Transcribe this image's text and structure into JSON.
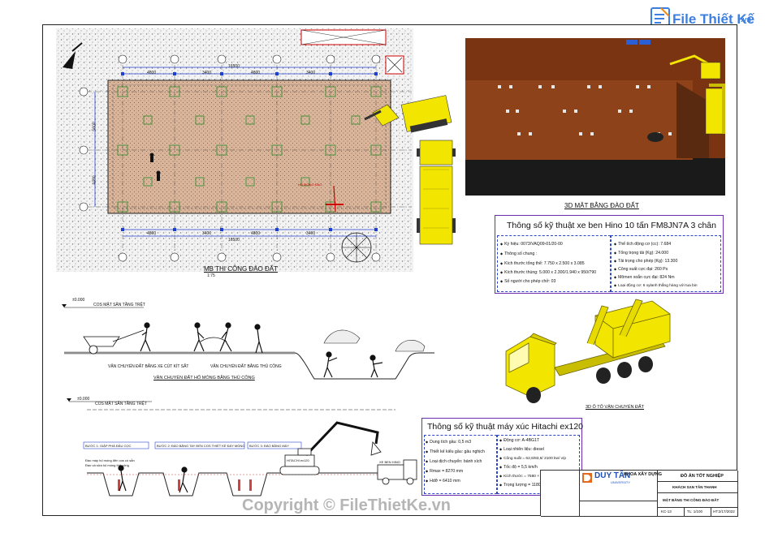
{
  "watermark_top": {
    "brand": "File Thiết Kế",
    "suffix": ".vn"
  },
  "watermark_bottom": "Copyright © FileThietKe.vn",
  "plan": {
    "title": "MB THI CÔNG ĐÀO ĐẤT",
    "scale": "1:75",
    "dims_top": [
      "4800",
      "3400",
      "4800",
      "3400"
    ],
    "dims_top_total": "16500",
    "dims_bottom": [
      "4800",
      "3400",
      "4800",
      "3400"
    ],
    "dims_bottom_total": "16500",
    "dims_left": [
      "5600",
      "4490"
    ],
    "grid_letters": [
      "D",
      "D",
      "D",
      "D",
      "D",
      "D"
    ],
    "grid_rows": [
      "D",
      "D",
      "D"
    ],
    "label_callout": "HỐ MÓNG ĐÀO"
  },
  "view3d": {
    "title": "3D MẶT BẰNG ĐÀO ĐẤT"
  },
  "hino": {
    "title": "Thông số kỹ thuật xe ben Hino 10 tấn FM8JN7A 3 chân",
    "left": [
      "Ký hiệu: 0073/VAQ09-01/20-00",
      "Thông số chung :",
      "Kích thước tổng thể: 7.750 x 2.500 x 3.085",
      "Kích thước thùng: 5.000 x 2.300/1.940 x 950/790",
      "Số người cho phép chở: 03"
    ],
    "right": [
      "Thể tích động cơ (cc): 7.684",
      "Tổng trọng tải (Kg): 24.000",
      "Tải trọng cho phép (Kg): 13.300",
      "Công suất cực đại: 260 Ps",
      "Mômen xoắn cực đại: 824 Nm",
      "Loại động cơ: 6 xylanh thẳng hàng với tua bin"
    ]
  },
  "truck3d": {
    "title": "3D Ô TÔ VẬN CHUYỂN ĐẤT"
  },
  "section1": {
    "ground_label": "COS MẶT SÂN TẦNG TRỆT",
    "ground_value": "±0.000",
    "caption1": "VẬN CHUYỂN ĐẤT BẰNG XE CÚT KÍT SẮT",
    "caption2": "VẬN CHUYỂN ĐẤT BẰNG THỦ CÔNG",
    "title": "VẬN CHUYỂN ĐẤT HỐ MÓNG BẰNG THỦ CÔNG"
  },
  "section2": {
    "ground_label": "COS MẶT SÂN TẦNG TRỆT",
    "ground_value": "±0.000",
    "step1": "BƯỚC 1: GIẬP PHÁ ĐẦU CỌC",
    "step2": "BƯỚC 2: ĐÀO BẰNG TAY ĐẾN COS THIẾT KẾ ĐÁY MÓNG",
    "step3": "BƯỚC 3: ĐÀO BẰNG MÁY",
    "note1": "Đào máy hố móng đến cos có sẵn",
    "note2": "Đào và sửa hố móng thủ công",
    "machine": "HITACHI ex120",
    "truck": "XE BEN HINO"
  },
  "hitachi": {
    "title": "Thông số kỹ thuật máy xúc Hitachi ex120",
    "left": [
      "Dung tích gầu: 0,5 m3",
      "Thiết kế kiểu gầu: gầu nghịch",
      "Loại dịch chuyển: bánh xích",
      "Rmax = 8270 mm",
      "Hdỡ = 6410 mm"
    ],
    "right": [
      "Động cơ: A-4BG1T",
      "Loại nhiên liệu: diesel",
      "Công suất = 62,6/83,6/ 2100 kw/ v/p",
      "Tốc độ = 5,5 km/h",
      "Kích thước = 7580 × 2500 × 2720 mm",
      "Trọng lượng = 11800 kg"
    ]
  },
  "titleblock": {
    "logo_main": "DUY TÂN",
    "logo_sub": "UNIVERSITY",
    "faculty": "KHOA XÂY DỰNG",
    "project": "ĐỒ ÁN TỐT NGHIỆP",
    "student": "KHÁCH SẠN TÂN THANH",
    "drawing": "MẶT BẰNG THI CÔNG ĐÀO ĐẤT",
    "sheet": "KC-13",
    "scale": "TL: 1/100",
    "date": "HT:2/17/2022"
  },
  "colors": {
    "grid_blue": "#1f3fd0",
    "plan_fill": "#d9b59c",
    "dirt_3d": "#8a3b16",
    "machine_yellow": "#f2e600",
    "spec_border": "#6a2fb0",
    "logo_blue": "#1f4fb4",
    "logo_orange": "#e36a1e"
  }
}
